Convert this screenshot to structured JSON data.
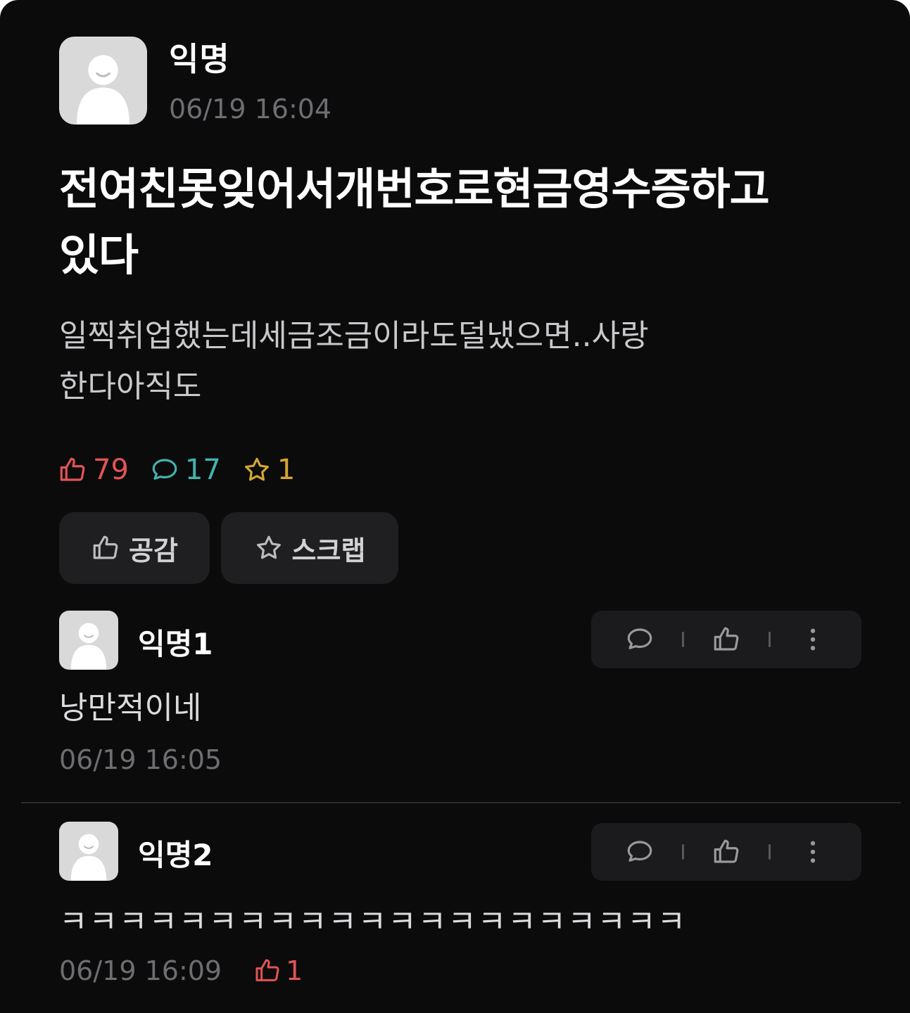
{
  "post": {
    "author": "익명",
    "time": "06/19 16:04",
    "title_line1": "전여친못잊어서개번호로현금영수증하고",
    "title_line2": "있다",
    "body_line1": "일찍취업했는데세금조금이라도덜냈으면..사랑",
    "body_line2": "한다아직도",
    "likes": "79",
    "comments": "17",
    "scraps": "1"
  },
  "buttons": {
    "like_label": "공감",
    "scrap_label": "스크랩"
  },
  "comments": [
    {
      "author": "익명1",
      "text": "낭만적이네",
      "time": "06/19 16:05"
    },
    {
      "author": "익명2",
      "text": "ㅋㅋㅋㅋㅋㅋㅋㅋㅋㅋㅋㅋㅋㅋㅋㅋㅋㅋㅋㅋㅋ",
      "time": "06/19 16:09",
      "likes": "1"
    }
  ],
  "icons": {
    "avatar": "anonymous-avatar",
    "like": "thumbs-up-icon",
    "comment": "comment-bubble-icon",
    "scrap": "star-icon",
    "more": "more-vertical-icon"
  },
  "colors": {
    "background": "#0b0b0c",
    "like": "#e25454",
    "comment": "#43b3ae",
    "scrap": "#d4a634",
    "muted": "#6d6d72"
  }
}
